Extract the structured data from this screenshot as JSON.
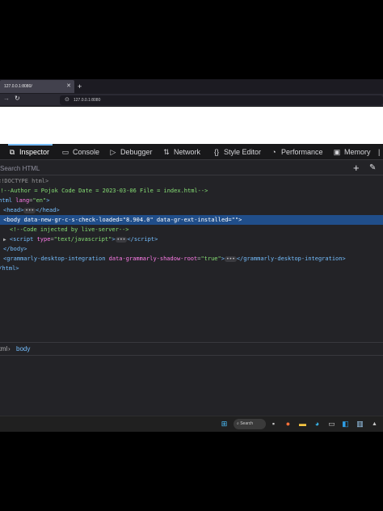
{
  "browser": {
    "tab_title": "127.0.0.1:8080/",
    "url": "127.0.0.1:8080"
  },
  "devtools": {
    "tabs": [
      {
        "label": "Inspector",
        "icon": "inspector-icon"
      },
      {
        "label": "Console",
        "icon": "console-icon"
      },
      {
        "label": "Debugger",
        "icon": "debugger-icon"
      },
      {
        "label": "Network",
        "icon": "network-icon"
      },
      {
        "label": "Style Editor",
        "icon": "style-editor-icon"
      },
      {
        "label": "Performance",
        "icon": "performance-icon"
      },
      {
        "label": "Memory",
        "icon": "memory-icon"
      }
    ],
    "search_placeholder": "Search HTML",
    "markup": {
      "doctype": "<!DOCTYPE html>",
      "comment_author": "<!--Author = Pojok Code Date = 2023-03-06 File = index.html-->",
      "html_tag": "html",
      "html_attr": "lang",
      "html_val": "\"en\"",
      "head_tag": "head",
      "body_tag": "body",
      "body_attr1": "data-new-gr-c-s-check-loaded",
      "body_val1": "\"8.904.0\"",
      "body_attr2": "data-gr-ext-installed",
      "body_val2": "\"\"",
      "comment_live": "<!--Code injected by live-server-->",
      "script_tag": "script",
      "script_attr": "type",
      "script_val": "\"text/javascript\"",
      "grammarly_tag": "grammarly-desktop-integration",
      "grammarly_attr": "data-grammarly-shadow-root",
      "grammarly_val": "\"true\"",
      "ellipsis": "•••"
    },
    "breadcrumb": {
      "html": "html",
      "body": "body"
    }
  },
  "taskbar": {
    "search_label": "Search"
  }
}
